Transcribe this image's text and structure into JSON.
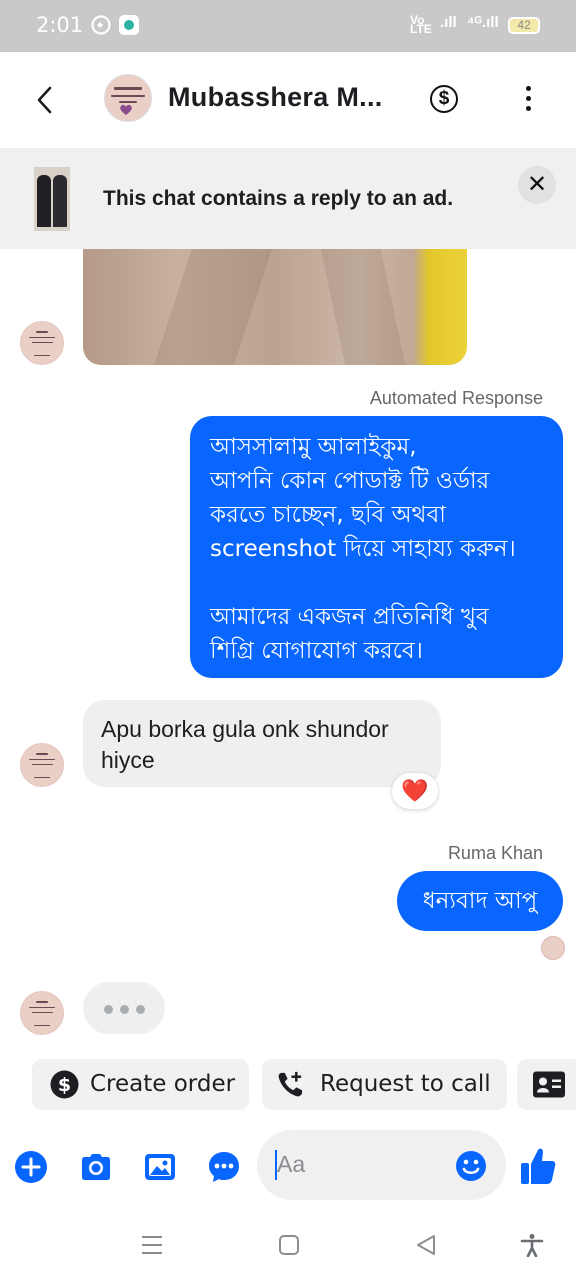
{
  "status_bar": {
    "time": "2:01",
    "network_label": "Vo\nLTE",
    "signal_1": ".ıll",
    "signal_2": "⁴ᴳ.ıll",
    "battery": "42"
  },
  "header": {
    "contact_name": "Mubasshera M...",
    "icons": [
      "back-arrow-icon",
      "dollar-circle-icon",
      "more-vertical-icon"
    ]
  },
  "ad_banner": {
    "text": "This chat contains a reply to an ad.",
    "close_glyph": "✕"
  },
  "messages": {
    "automated_label": "Automated Response",
    "automated_line_1": "আসসালামু আলাইকুম,",
    "automated_line_2": "আপনি কোন পোডাক্ট টি ওর্ডার",
    "automated_line_3": "করতে চাচ্ছেন, ছবি অথবা",
    "automated_line_4": "screenshot দিয়ে সাহায্য করুন।",
    "automated_line_5": "আমাদের একজন প্রতিনিধি খুব",
    "automated_line_6": "শিগ্রি যোগাযোগ করবে।",
    "incoming_text": "Apu borka gula onk shundor hiyce",
    "reaction": "❤️",
    "sender_label": "Ruma Khan",
    "outgoing_text": "ধন্যবাদ আপু"
  },
  "quick_actions": {
    "create_order": "Create order",
    "request_call": "Request to call"
  },
  "composer": {
    "placeholder": "Aa"
  },
  "colors": {
    "accent": "#0866ff",
    "bubble_in": "#efefef",
    "banner_bg": "#f0f0f0",
    "status_bar_bg": "#c9c9c9",
    "reaction_heart": "#e41e3f"
  }
}
